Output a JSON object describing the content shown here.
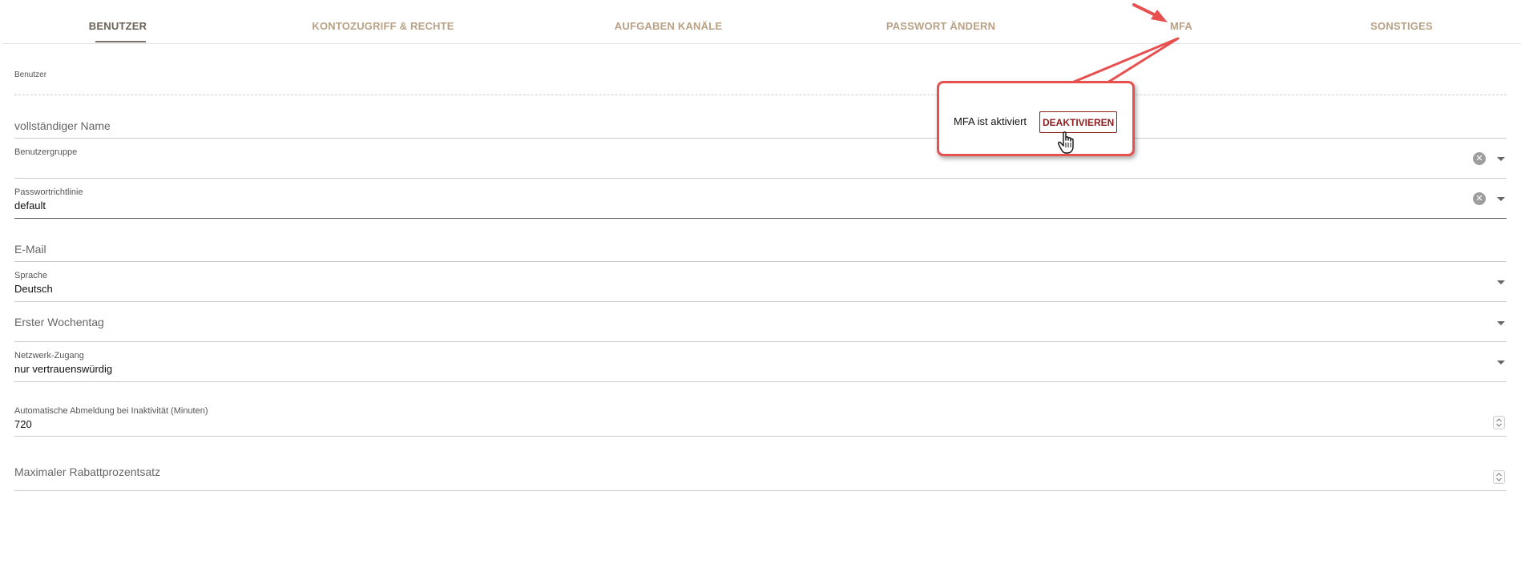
{
  "tabs": [
    {
      "label": "Benutzer"
    },
    {
      "label": "Kontozugriff & Rechte"
    },
    {
      "label": "Aufgaben Kanäle"
    },
    {
      "label": "Passwort ändern"
    },
    {
      "label": "MFA"
    },
    {
      "label": "Sonstiges"
    }
  ],
  "active_tab": "Benutzer",
  "section": {
    "title": "Benutzer"
  },
  "fields": {
    "full_name": {
      "placeholder": "vollständiger Name"
    },
    "user_group": {
      "label": "Benutzergruppe",
      "value": ""
    },
    "password_policy": {
      "label": "Passwortrichtlinie",
      "value": "default"
    },
    "email": {
      "placeholder": "E-Mail"
    },
    "language": {
      "label": "Sprache",
      "value": "Deutsch"
    },
    "first_weekday": {
      "placeholder": "Erster Wochentag"
    },
    "network_access": {
      "label": "Netzwerk-Zugang",
      "value": "nur vertrauenswürdig"
    },
    "auto_logout": {
      "label": "Automatische Abmeldung bei Inaktivität (Minuten)",
      "value": "720"
    },
    "max_discount": {
      "placeholder": "Maximaler Rabattprozentsatz"
    }
  },
  "mfa_popup": {
    "status_text": "MFA ist aktiviert",
    "button_label": "DEAKTIVIEREN"
  },
  "icons": {
    "clear": "clear-circle-icon",
    "dropdown": "caret-down-icon",
    "spinner": "number-spinner-icon",
    "cursor": "hand-pointer-icon"
  },
  "colors": {
    "tab_text": "#b8a184",
    "tab_active": "#6b6157",
    "annotation": "#e85050",
    "button": "#8a1c1c"
  }
}
